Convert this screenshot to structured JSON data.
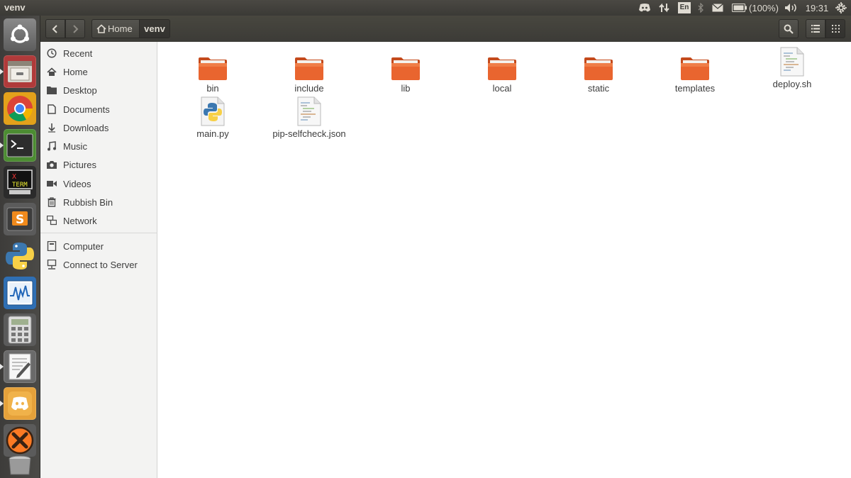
{
  "top_panel": {
    "app_title": "venv",
    "battery_label": "(100%)",
    "clock": "19:31",
    "keyboard_layout": "En"
  },
  "launcher": {
    "items": [
      {
        "name": "ubuntu-dash-icon"
      },
      {
        "name": "files-app-icon",
        "running": true
      },
      {
        "name": "chrome-app-icon"
      },
      {
        "name": "terminal-app-icon",
        "running": true
      },
      {
        "name": "xterm-app-icon"
      },
      {
        "name": "sublime-text-app-icon"
      },
      {
        "name": "python-app-icon"
      },
      {
        "name": "system-monitor-app-icon"
      },
      {
        "name": "calculator-app-icon"
      },
      {
        "name": "text-editor-app-icon",
        "running": true
      },
      {
        "name": "discord-app-icon",
        "running": true
      },
      {
        "name": "xampp-app-icon"
      },
      {
        "name": "trash-app-icon"
      }
    ]
  },
  "header": {
    "breadcrumbs": [
      "Home",
      "venv"
    ]
  },
  "sidebar": {
    "items": [
      {
        "label": "Recent",
        "icon": "clock-icon"
      },
      {
        "label": "Home",
        "icon": "home-icon"
      },
      {
        "label": "Desktop",
        "icon": "folder-icon"
      },
      {
        "label": "Documents",
        "icon": "document-icon"
      },
      {
        "label": "Downloads",
        "icon": "download-icon"
      },
      {
        "label": "Music",
        "icon": "music-icon"
      },
      {
        "label": "Pictures",
        "icon": "camera-icon"
      },
      {
        "label": "Videos",
        "icon": "video-icon"
      },
      {
        "label": "Rubbish Bin",
        "icon": "trash-icon"
      },
      {
        "label": "Network",
        "icon": "network-icon"
      }
    ],
    "items2": [
      {
        "label": "Computer",
        "icon": "computer-icon"
      },
      {
        "label": "Connect to Server",
        "icon": "server-icon"
      }
    ]
  },
  "files": [
    {
      "name": "bin",
      "type": "folder"
    },
    {
      "name": "include",
      "type": "folder"
    },
    {
      "name": "lib",
      "type": "folder"
    },
    {
      "name": "local",
      "type": "folder"
    },
    {
      "name": "static",
      "type": "folder"
    },
    {
      "name": "templates",
      "type": "folder"
    },
    {
      "name": "deploy.sh",
      "type": "text"
    },
    {
      "name": "main.py",
      "type": "python"
    },
    {
      "name": "pip-selfcheck.json",
      "type": "text"
    }
  ],
  "colors": {
    "folder_orange": "#e9652f",
    "panel_dark": "#3c3b37",
    "sidebar_bg": "#f3f3f2"
  }
}
